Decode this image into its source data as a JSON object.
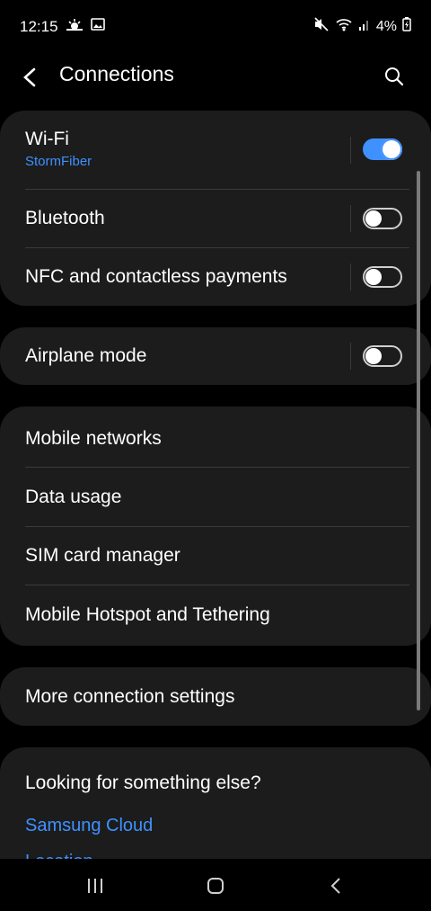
{
  "status": {
    "time": "12:15",
    "battery": "4%"
  },
  "header": {
    "title": "Connections"
  },
  "groups": {
    "g1": {
      "wifi": {
        "label": "Wi-Fi",
        "network": "StormFiber",
        "on": true
      },
      "bluetooth": {
        "label": "Bluetooth",
        "on": false
      },
      "nfc": {
        "label": "NFC and contactless payments",
        "on": false
      }
    },
    "g2": {
      "airplane": {
        "label": "Airplane mode",
        "on": false
      }
    },
    "g3": {
      "mobile_networks": "Mobile networks",
      "data_usage": "Data usage",
      "sim_manager": "SIM card manager",
      "hotspot": "Mobile Hotspot and Tethering"
    },
    "g4": {
      "more": "More connection settings"
    }
  },
  "suggestions": {
    "heading": "Looking for something else?",
    "links": [
      "Samsung Cloud",
      "Location"
    ]
  },
  "colors": {
    "accent": "#3e91ff",
    "card": "#1c1c1c",
    "background": "#000000"
  },
  "icons": {
    "status_left": [
      "weather-icon",
      "image-icon"
    ],
    "status_right": [
      "mute-icon",
      "wifi-icon",
      "signal-icon",
      "battery-icon"
    ],
    "navigation": [
      "recent-apps-icon",
      "home-icon",
      "back-icon"
    ]
  }
}
